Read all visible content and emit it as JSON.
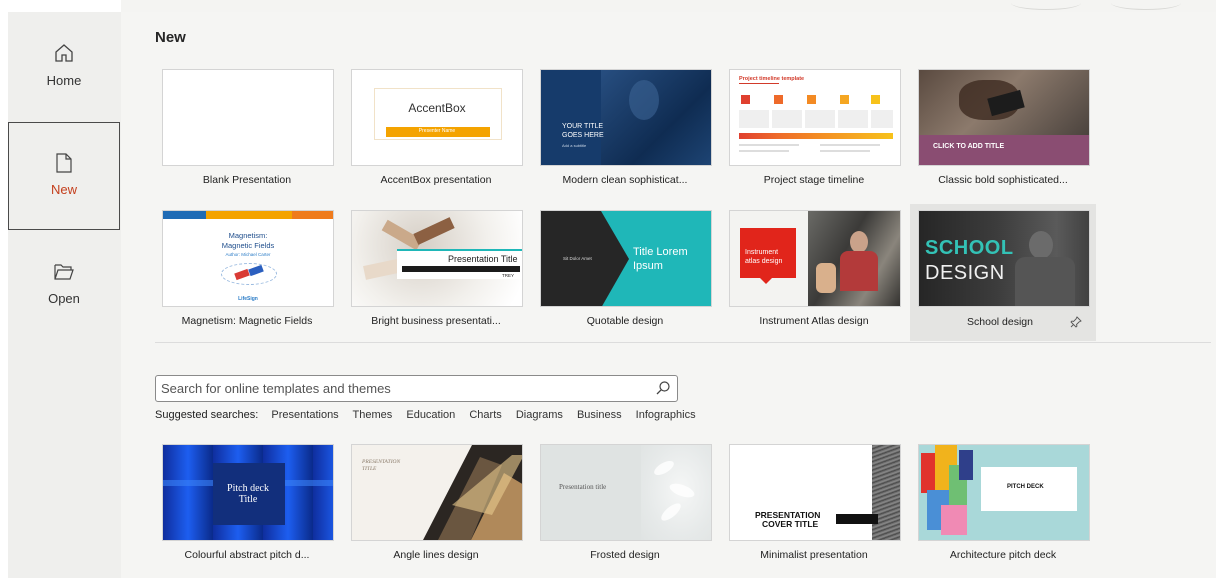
{
  "nav": {
    "home": "Home",
    "new": "New",
    "open": "Open"
  },
  "page_title": "New",
  "templates": [
    {
      "caption": "Blank Presentation"
    },
    {
      "caption": "AccentBox presentation",
      "thumb_title": "AccentBox",
      "thumb_sub": "Presenter Name"
    },
    {
      "caption": "Modern clean sophisticat...",
      "thumb_title_1": "YOUR TITLE",
      "thumb_title_2": "GOES HERE",
      "thumb_sub": "Add a subtitle"
    },
    {
      "caption": "Project stage timeline",
      "thumb_title": "Project timeline template"
    },
    {
      "caption": "Classic bold sophisticated...",
      "thumb_title": "CLICK TO ADD TITLE"
    },
    {
      "caption": "Magnetism: Magnetic Fields",
      "thumb_title_1": "Magnetism:",
      "thumb_title_2": "Magnetic Fields",
      "thumb_sub": "Author: Michael Carter",
      "thumb_logo": "LifeSign"
    },
    {
      "caption": "Bright business presentati...",
      "thumb_title": "Presentation Title",
      "thumb_sub": "TREY"
    },
    {
      "caption": "Quotable design",
      "thumb_small": "Sit Dolor Amet",
      "thumb_title_1": "Title Lorem",
      "thumb_title_2": "Ipsum"
    },
    {
      "caption": "Instrument Atlas design",
      "thumb_title_1": "Instrument",
      "thumb_title_2": "atlas design"
    },
    {
      "caption": "School design",
      "thumb_title_1": "SCHOOL",
      "thumb_title_2": "DESIGN"
    }
  ],
  "search": {
    "placeholder": "Search for online templates and themes",
    "suggested_label": "Suggested searches:",
    "suggestions": [
      "Presentations",
      "Themes",
      "Education",
      "Charts",
      "Diagrams",
      "Business",
      "Infographics"
    ]
  },
  "online_templates": [
    {
      "caption": "Colourful abstract pitch d...",
      "thumb_title_1": "Pitch deck",
      "thumb_title_2": "Title"
    },
    {
      "caption": "Angle lines design",
      "thumb_title_1": "PRESENTATION",
      "thumb_title_2": "TITLE"
    },
    {
      "caption": "Frosted design",
      "thumb_title": "Presentation title"
    },
    {
      "caption": "Minimalist presentation",
      "thumb_title_1": "PRESENTATION",
      "thumb_title_2": "COVER TITLE"
    },
    {
      "caption": "Architecture pitch deck",
      "thumb_title": "PITCH DECK"
    }
  ],
  "colors": {
    "accent": "#c43e1c",
    "orange": "#f4a300",
    "teal": "#1fb7b8",
    "navy": "#163b6b",
    "plum": "#8a4d72"
  },
  "icons": {
    "home": "home-icon",
    "new": "new-document-icon",
    "open": "open-folder-icon",
    "search": "search-icon",
    "pin": "pin-icon"
  }
}
